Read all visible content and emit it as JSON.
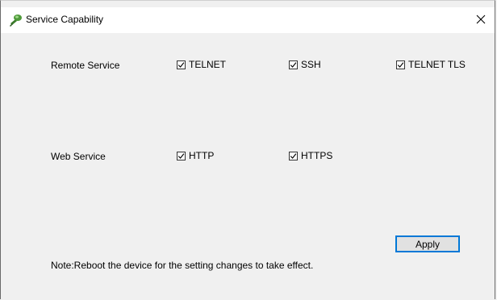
{
  "window": {
    "title": "Service Capability",
    "icon": "service-capability-icon",
    "close_glyph": "✕"
  },
  "remote": {
    "label": "Remote Service",
    "options": [
      {
        "label": "TELNET",
        "checked": true
      },
      {
        "label": "SSH",
        "checked": true
      },
      {
        "label": "TELNET TLS",
        "checked": true
      }
    ]
  },
  "web": {
    "label": "Web Service",
    "options": [
      {
        "label": "HTTP",
        "checked": true
      },
      {
        "label": "HTTPS",
        "checked": true
      }
    ]
  },
  "apply_label": "Apply",
  "note": "Note:Reboot the device for the setting changes to take effect.",
  "colors": {
    "accent": "#0078d7",
    "titlebar_bg": "#ffffff",
    "client_bg": "#f0f0f0"
  }
}
